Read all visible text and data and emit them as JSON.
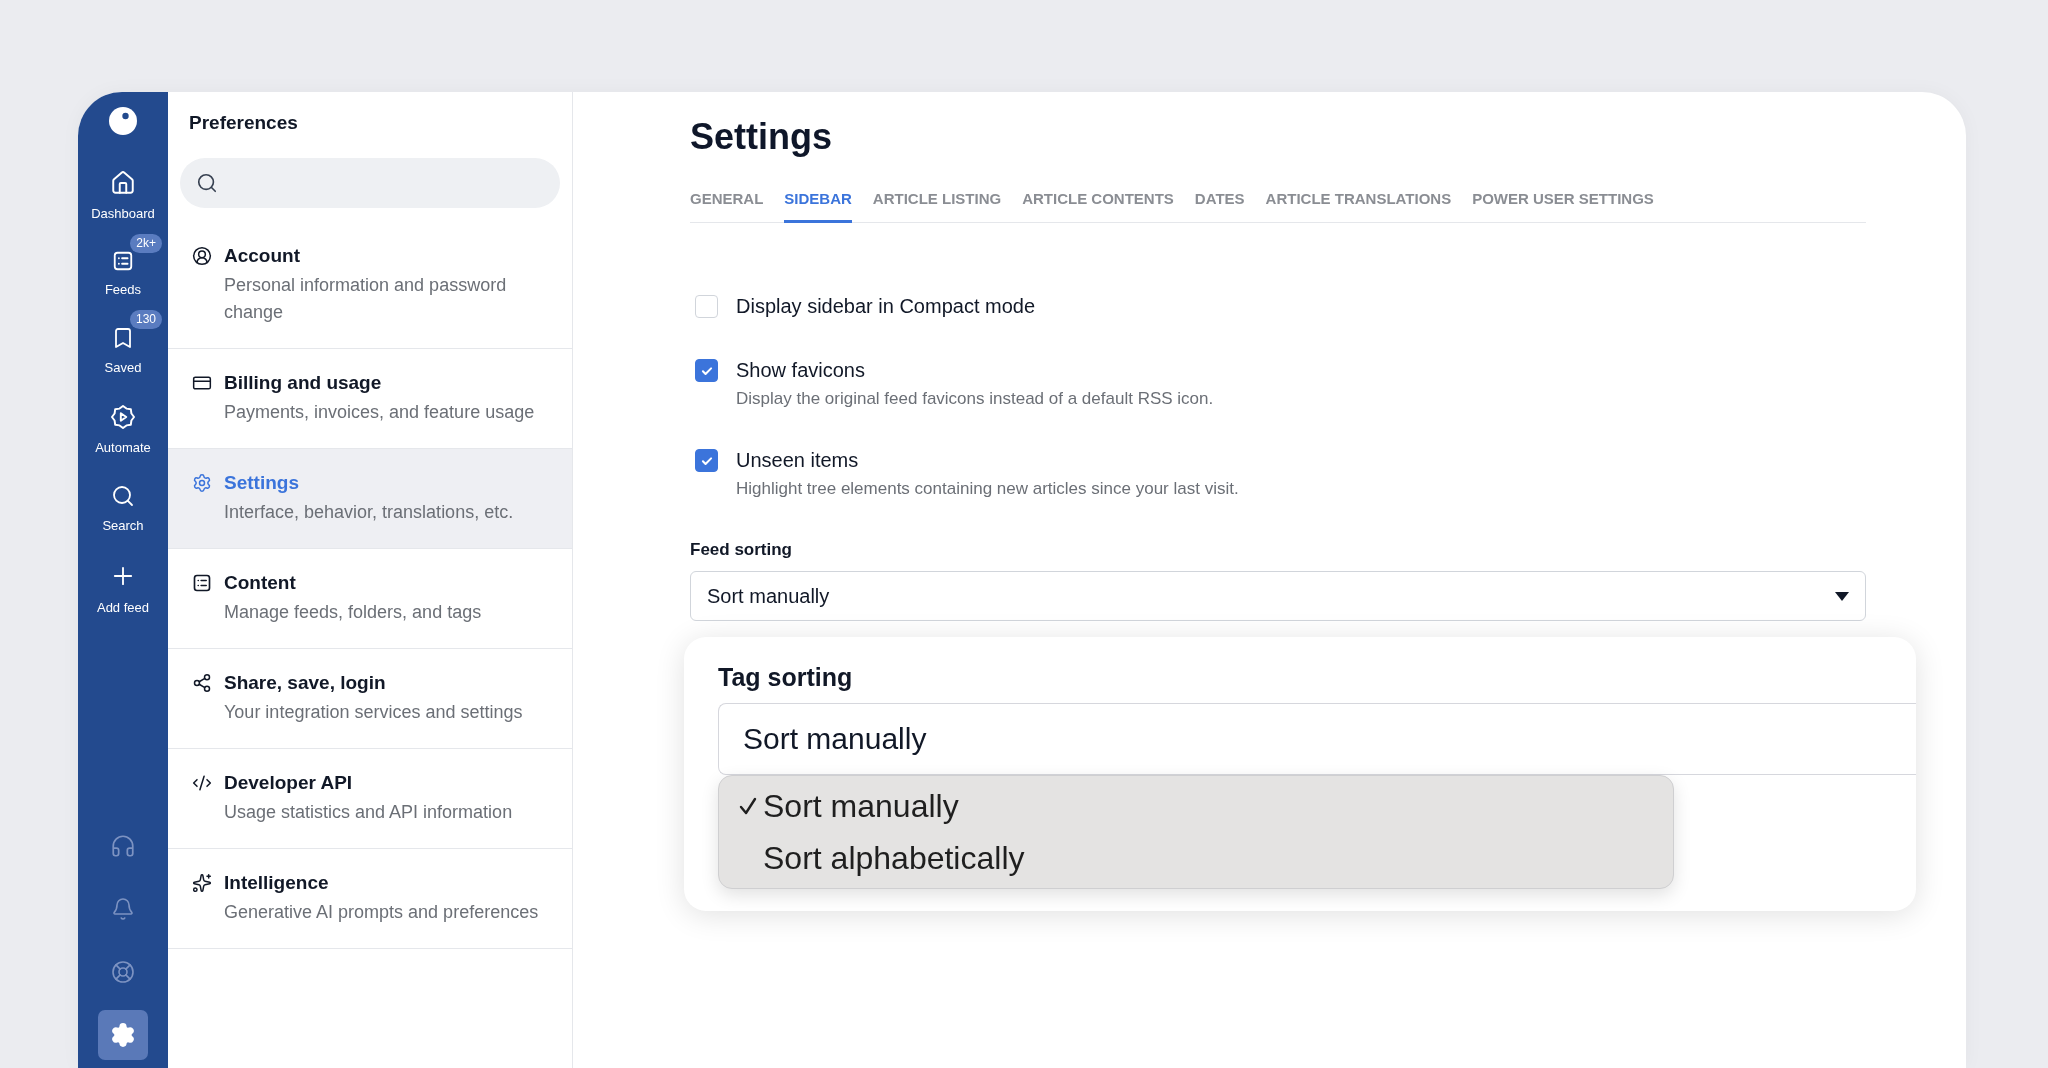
{
  "rail": {
    "items": [
      {
        "label": "Dashboard",
        "selected": false
      },
      {
        "label": "Feeds",
        "badge": "2k+",
        "selected": false
      },
      {
        "label": "Saved",
        "badge": "130",
        "selected": false
      },
      {
        "label": "Automate",
        "selected": false
      },
      {
        "label": "Search",
        "selected": false
      },
      {
        "label": "Add feed",
        "selected": false
      }
    ],
    "bottom_items": [
      {
        "selected": false
      },
      {
        "selected": false
      },
      {
        "selected": false
      },
      {
        "selected": true
      }
    ]
  },
  "preferences": {
    "title": "Preferences",
    "items": [
      {
        "title": "Account",
        "description": "Personal information and password change",
        "selected": false
      },
      {
        "title": "Billing and usage",
        "description": "Payments, invoices, and feature usage",
        "selected": false
      },
      {
        "title": "Settings",
        "description": "Interface, behavior, translations, etc.",
        "selected": true
      },
      {
        "title": "Content",
        "description": "Manage feeds, folders, and tags",
        "selected": false
      },
      {
        "title": "Share, save, login",
        "description": "Your integration services and settings",
        "selected": false
      },
      {
        "title": "Developer API",
        "description": "Usage statistics and API information",
        "selected": false
      },
      {
        "title": "Intelligence",
        "description": "Generative AI prompts and preferences",
        "selected": false
      }
    ]
  },
  "main": {
    "title": "Settings",
    "tabs": [
      {
        "label": "GENERAL",
        "selected": false
      },
      {
        "label": "SIDEBAR",
        "selected": true
      },
      {
        "label": "ARTICLE LISTING",
        "selected": false
      },
      {
        "label": "ARTICLE CONTENTS",
        "selected": false
      },
      {
        "label": "DATES",
        "selected": false
      },
      {
        "label": "ARTICLE TRANSLATIONS",
        "selected": false
      },
      {
        "label": "POWER USER SETTINGS",
        "selected": false
      }
    ],
    "options": [
      {
        "label": "Display sidebar in Compact mode",
        "checked": false
      },
      {
        "label": "Show favicons",
        "description": "Display the original feed favicons instead of a default RSS icon.",
        "checked": true
      },
      {
        "label": "Unseen items",
        "description": "Highlight tree elements containing new articles since your last visit.",
        "checked": true
      }
    ],
    "feed_sorting": {
      "label": "Feed sorting",
      "value": "Sort manually"
    },
    "tag_sorting": {
      "label": "Tag sorting",
      "value": "Sort manually",
      "options": [
        {
          "label": "Sort manually",
          "selected": true
        },
        {
          "label": "Sort alphabetically",
          "selected": false
        }
      ]
    }
  }
}
